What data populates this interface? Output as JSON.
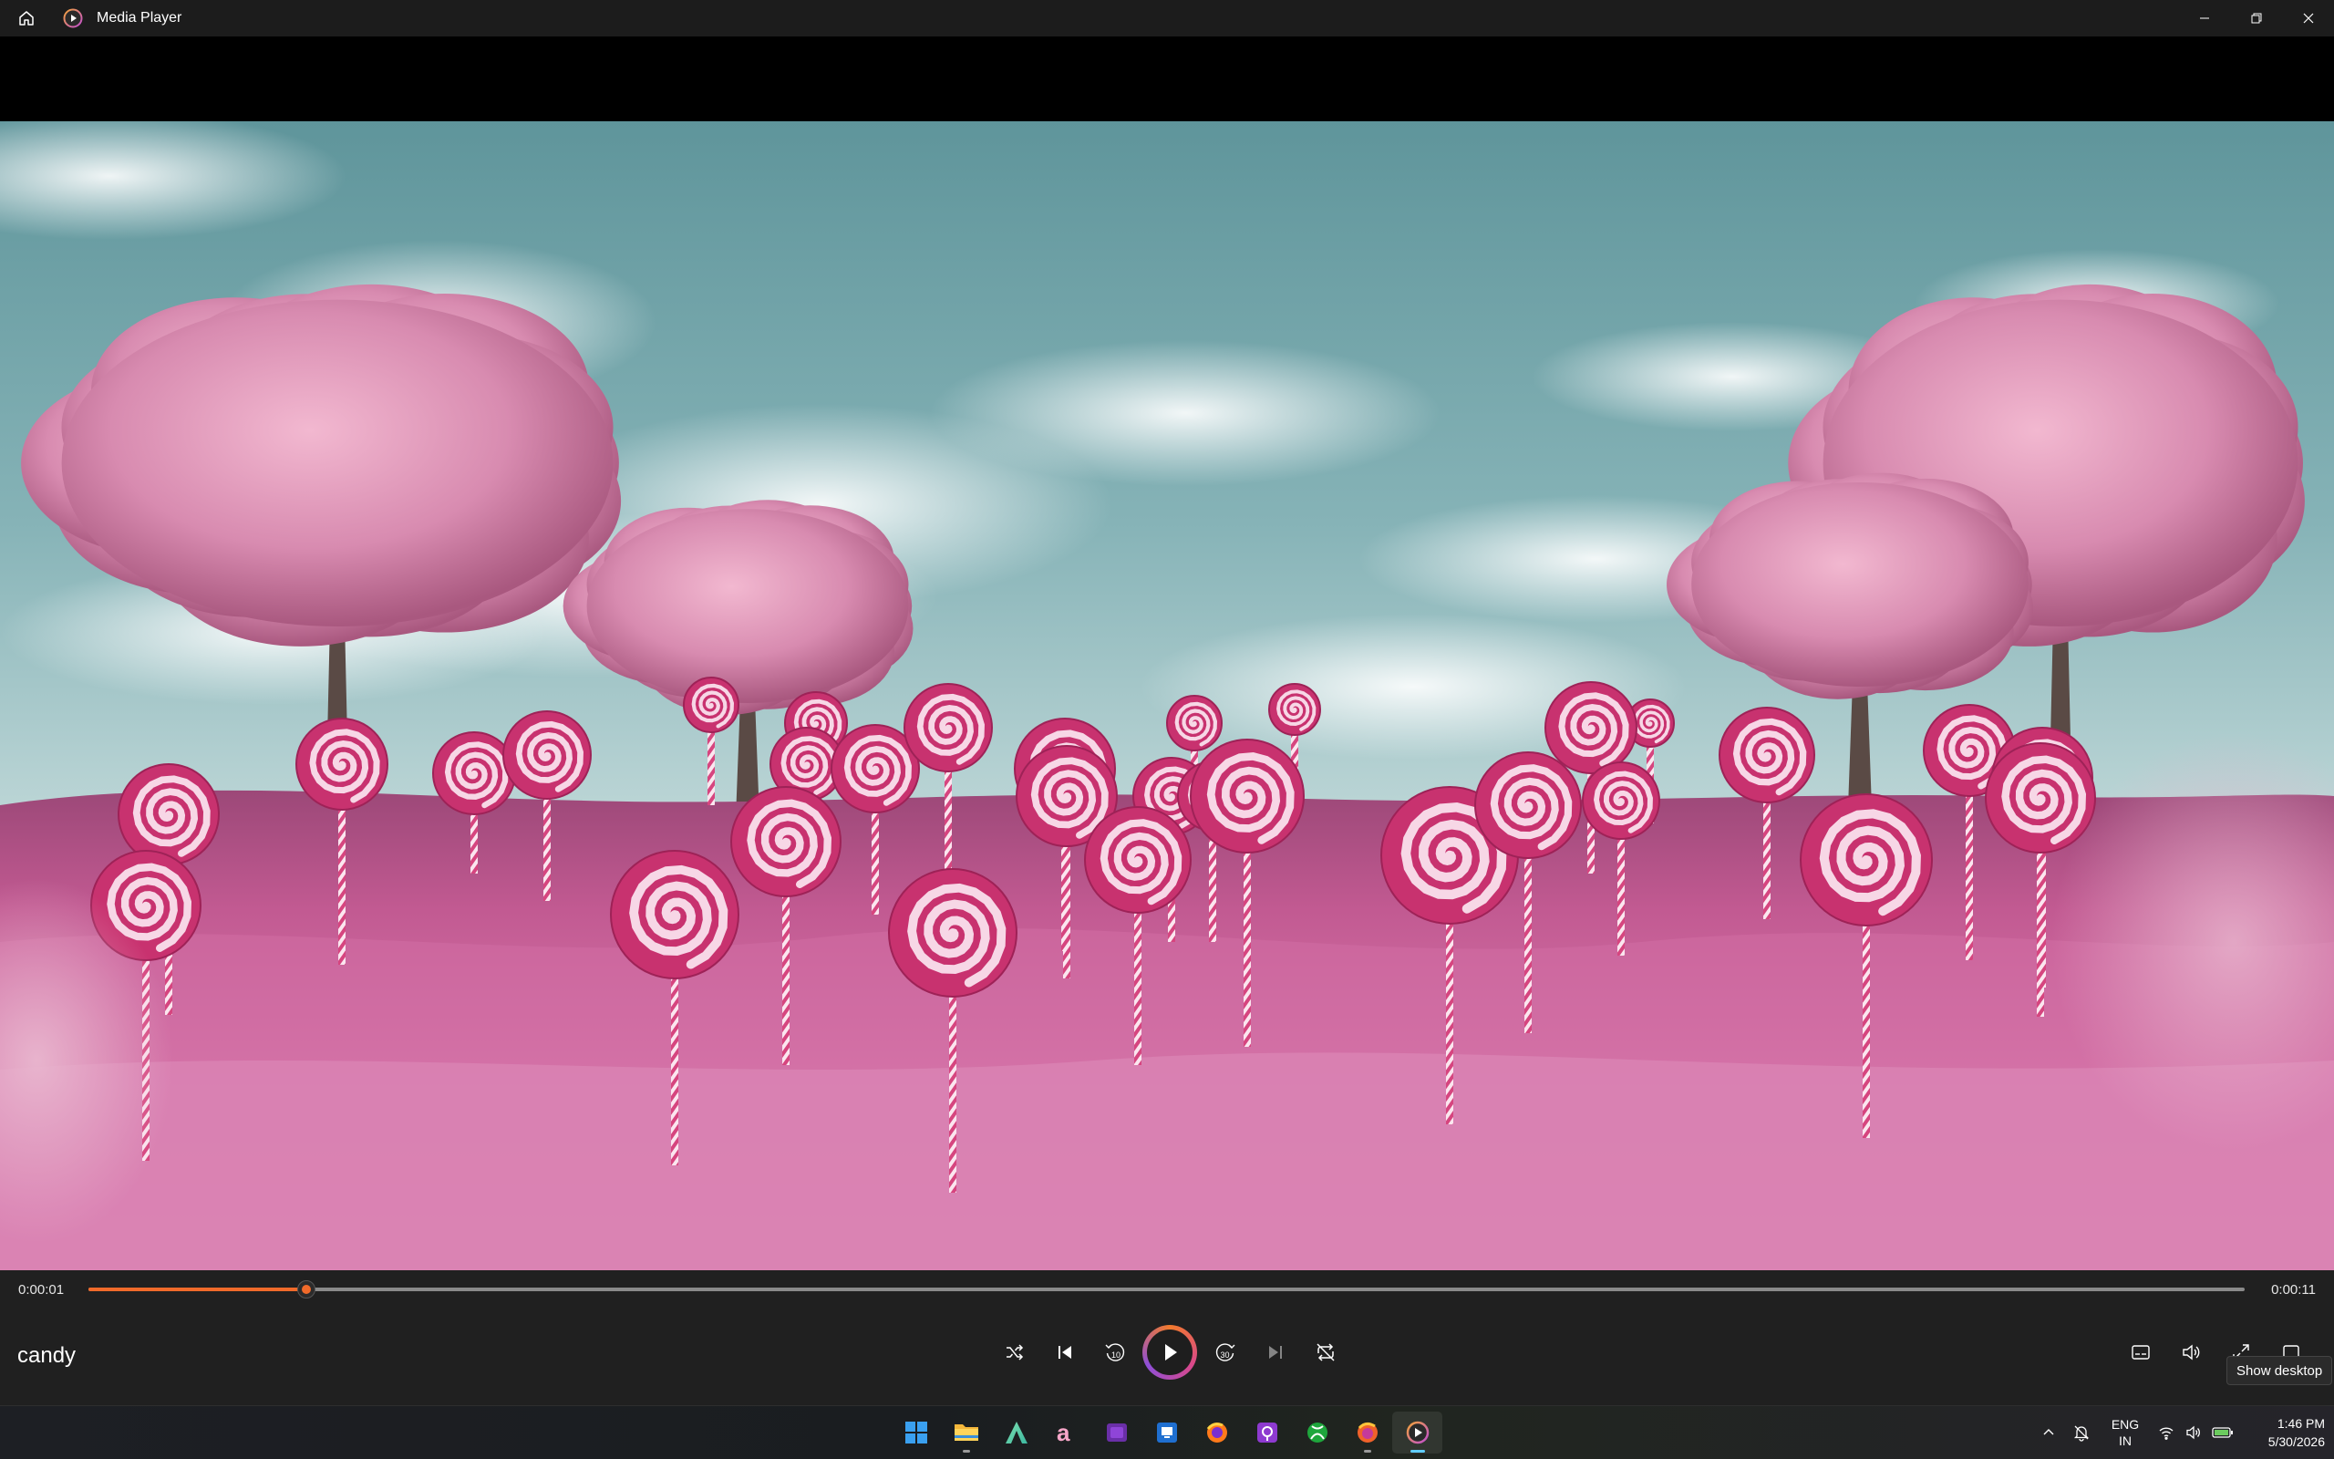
{
  "window": {
    "title": "Media Player",
    "icons": [
      "home-icon",
      "media-player-app-icon",
      "minimize-icon",
      "restore-icon",
      "close-icon"
    ]
  },
  "player": {
    "media_title": "candy",
    "current_time": "0:00:01",
    "total_time": "0:00:11",
    "progress": 0.101,
    "state": "paused",
    "accent_color": "#f06a2a",
    "transport_icons": [
      "shuffle-icon",
      "previous-icon",
      "skip-back-10-icon",
      "play-icon",
      "skip-forward-30-icon",
      "next-icon",
      "repeat-icon"
    ],
    "right_icons": [
      "captions-icon",
      "volume-icon",
      "fullscreen-icon",
      "miniplayer-icon"
    ]
  },
  "tooltip": {
    "text": "Show desktop"
  },
  "taskbar": {
    "apps": [
      {
        "name": "Start",
        "icon": "windows-start-icon",
        "running": false
      },
      {
        "name": "File Explorer",
        "icon": "file-explorer-icon",
        "running": true
      },
      {
        "name": "A app",
        "icon": "letter-a-app-icon",
        "running": false
      },
      {
        "name": "Amazon",
        "icon": "amazon-icon",
        "running": false
      },
      {
        "name": "Clipchamp",
        "icon": "clipchamp-icon",
        "running": false
      },
      {
        "name": "Remote Desktop",
        "icon": "remote-desktop-icon",
        "running": false
      },
      {
        "name": "Firefox",
        "icon": "firefox-icon",
        "running": false
      },
      {
        "name": "Podcast app",
        "icon": "podcast-icon",
        "running": false
      },
      {
        "name": "Xbox",
        "icon": "xbox-icon",
        "running": false
      },
      {
        "name": "Firefox Private",
        "icon": "firefox-alt-icon",
        "running": true
      },
      {
        "name": "Media Player",
        "icon": "media-player-icon",
        "running": true,
        "active": true
      }
    ],
    "tray": {
      "lang_line1": "ENG",
      "lang_line2": "IN",
      "time": "1:46 PM",
      "date": "5/30/2026",
      "icons": [
        "chevron-up-icon",
        "notifications-off-icon",
        "wifi-icon",
        "speaker-icon",
        "battery-icon"
      ]
    }
  }
}
